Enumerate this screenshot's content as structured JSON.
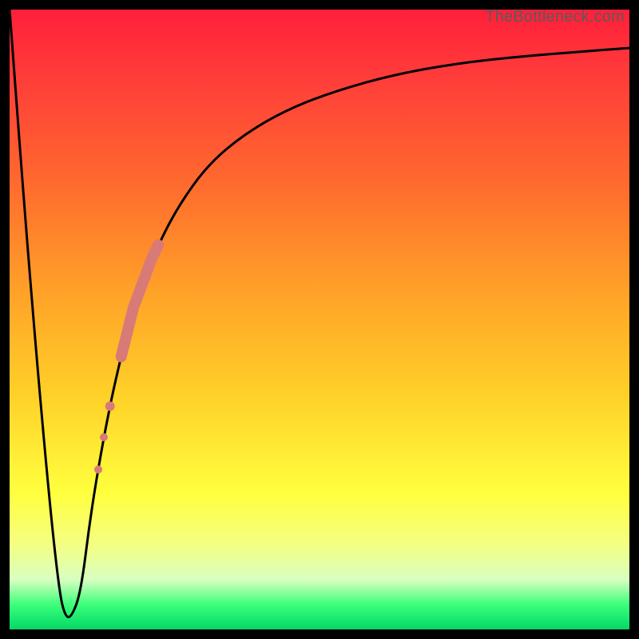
{
  "watermark": {
    "text": "TheBottleneck.com"
  },
  "colors": {
    "curve": "#000000",
    "marker": "#d87a78",
    "marker_stroke": "#d87a78"
  },
  "chart_data": {
    "type": "line",
    "title": "",
    "xlabel": "",
    "ylabel": "",
    "xlim": [
      0,
      100
    ],
    "ylim": [
      0,
      100
    ],
    "grid": false,
    "legend": false,
    "series": [
      {
        "name": "bottleneck-curve",
        "x": [
          0,
          3,
          6,
          8,
          9,
          10,
          11.5,
          13,
          15,
          17,
          20,
          23,
          27,
          32,
          38,
          45,
          53,
          62,
          72,
          82,
          92,
          100
        ],
        "y": [
          100,
          60,
          25,
          6,
          2,
          2,
          6,
          18,
          30,
          40,
          52,
          60,
          68,
          75,
          80,
          84,
          87,
          89.5,
          91.3,
          92.4,
          93.2,
          93.8
        ]
      }
    ],
    "overlays": [
      {
        "name": "highlight-band",
        "shape": "thick-segment",
        "x_range": [
          18,
          24
        ],
        "stroke_width": 14
      },
      {
        "name": "highlight-dots",
        "shape": "dots",
        "points": [
          {
            "x": 16.2,
            "r": 6
          },
          {
            "x": 15.2,
            "r": 5
          },
          {
            "x": 14.3,
            "r": 5
          }
        ]
      }
    ],
    "background_gradient_stops": [
      {
        "pos": 0,
        "color": "#ff1f3a"
      },
      {
        "pos": 10,
        "color": "#ff3a3a"
      },
      {
        "pos": 28,
        "color": "#ff6a2e"
      },
      {
        "pos": 45,
        "color": "#ffa028"
      },
      {
        "pos": 62,
        "color": "#ffd028"
      },
      {
        "pos": 78,
        "color": "#ffff3e"
      },
      {
        "pos": 86,
        "color": "#f5ff80"
      },
      {
        "pos": 92,
        "color": "#d8ffc0"
      },
      {
        "pos": 96,
        "color": "#3dff7a"
      },
      {
        "pos": 99,
        "color": "#10e26c"
      },
      {
        "pos": 100,
        "color": "#0bd565"
      }
    ]
  }
}
